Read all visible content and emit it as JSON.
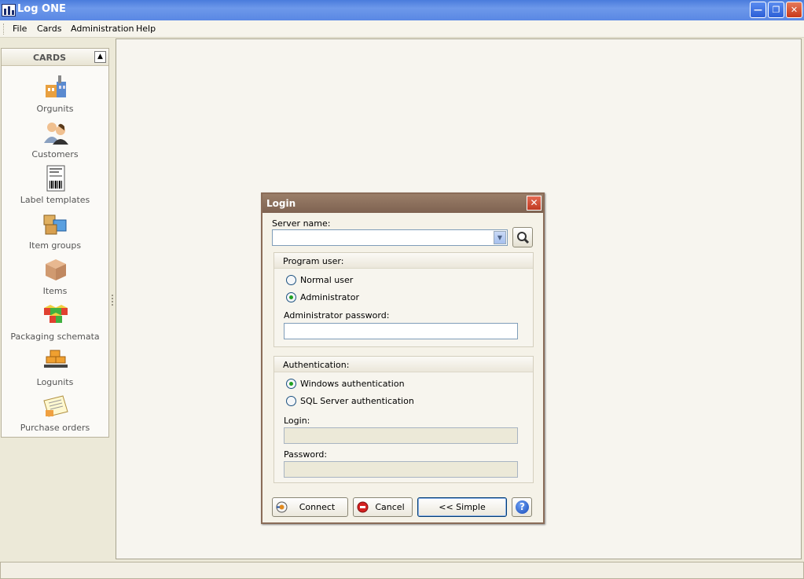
{
  "window": {
    "title": "Log ONE",
    "controls": [
      "minimize",
      "restore",
      "close"
    ]
  },
  "menu": [
    "File",
    "Cards",
    "Administration",
    "Help"
  ],
  "sidebar": {
    "title": "CARDS",
    "items": [
      {
        "label": "Orgunits",
        "icon": "factory-icon"
      },
      {
        "label": "Customers",
        "icon": "users-icon"
      },
      {
        "label": "Label templates",
        "icon": "barcode-label-icon"
      },
      {
        "label": "Item groups",
        "icon": "boxes-icon"
      },
      {
        "label": "Items",
        "icon": "box-icon"
      },
      {
        "label": "Packaging schemata",
        "icon": "colored-cubes-icon"
      },
      {
        "label": "Logunits",
        "icon": "pallet-icon"
      },
      {
        "label": "Purchase orders",
        "icon": "order-document-icon"
      }
    ]
  },
  "login_dialog": {
    "title": "Login",
    "server_name_label": "Server name:",
    "server_name_value": "",
    "program_user": {
      "title": "Program user:",
      "options": [
        "Normal user",
        "Administrator"
      ],
      "selected": "Administrator",
      "password_label": "Administrator password:",
      "password_value": ""
    },
    "authentication": {
      "title": "Authentication:",
      "options": [
        "Windows authentication",
        "SQL Server authentication"
      ],
      "selected": "Windows authentication",
      "login_label": "Login:",
      "password_label": "Password:"
    },
    "buttons": {
      "connect": "Connect",
      "cancel": "Cancel",
      "simple": "<< Simple",
      "help": "?"
    }
  },
  "colors": {
    "titlebar": "#4a7cdc",
    "dialog_title": "#8a6c58",
    "radio_check": "#21a121"
  }
}
